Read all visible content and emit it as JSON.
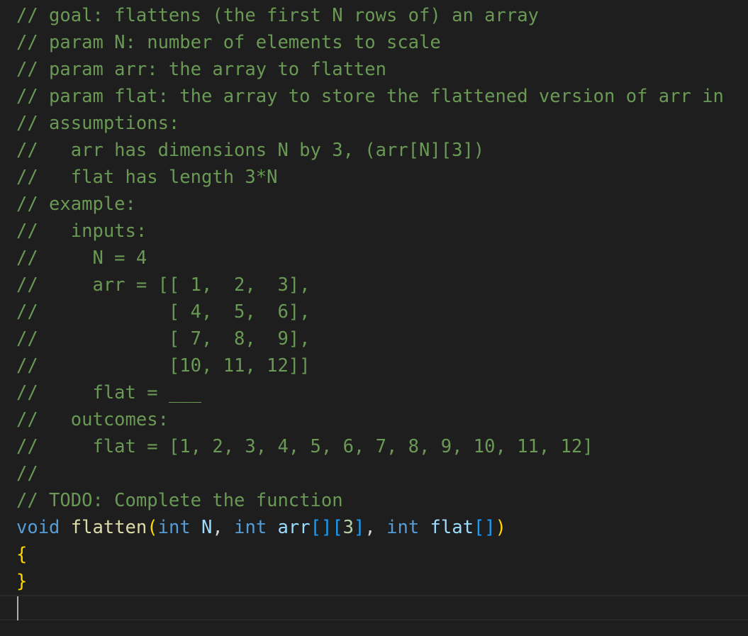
{
  "editor": {
    "comment_lines": [
      "// goal: flattens (the first N rows of) an array",
      "// param N: number of elements to scale",
      "// param arr: the array to flatten",
      "// param flat: the array to store the flattened version of arr in",
      "// assumptions:",
      "//   arr has dimensions N by 3, (arr[N][3])",
      "//   flat has length 3*N",
      "// example:",
      "//   inputs:",
      "//     N = 4",
      "//     arr = [[ 1,  2,  3],",
      "//            [ 4,  5,  6],",
      "//            [ 7,  8,  9],",
      "//            [10, 11, 12]]",
      "//     flat = ___",
      "//   outcomes:",
      "//     flat = [1, 2, 3, 4, 5, 6, 7, 8, 9, 10, 11, 12]",
      "//",
      "// TODO: Complete the function"
    ],
    "signature": {
      "return_type": "void",
      "function_name": "flatten",
      "open_paren": "(",
      "p1_type": "int",
      "p1_name": "N",
      "sep1": ", ",
      "p2_type": "int",
      "p2_name": "arr",
      "p2_brackets_1": "[]",
      "p2_dim_open": "[",
      "p2_dim_value": "3",
      "p2_dim_close": "]",
      "sep2": ", ",
      "p3_type": "int",
      "p3_name": "flat",
      "p3_brackets": "[]",
      "close_paren": ")"
    },
    "open_brace": "{",
    "close_brace": "}"
  },
  "colors": {
    "background": "#1e1e1e",
    "comment": "#6a9955",
    "keyword": "#569cd6",
    "function": "#dcdcaa",
    "parameter": "#9cdcfe",
    "number": "#b5cea8"
  }
}
